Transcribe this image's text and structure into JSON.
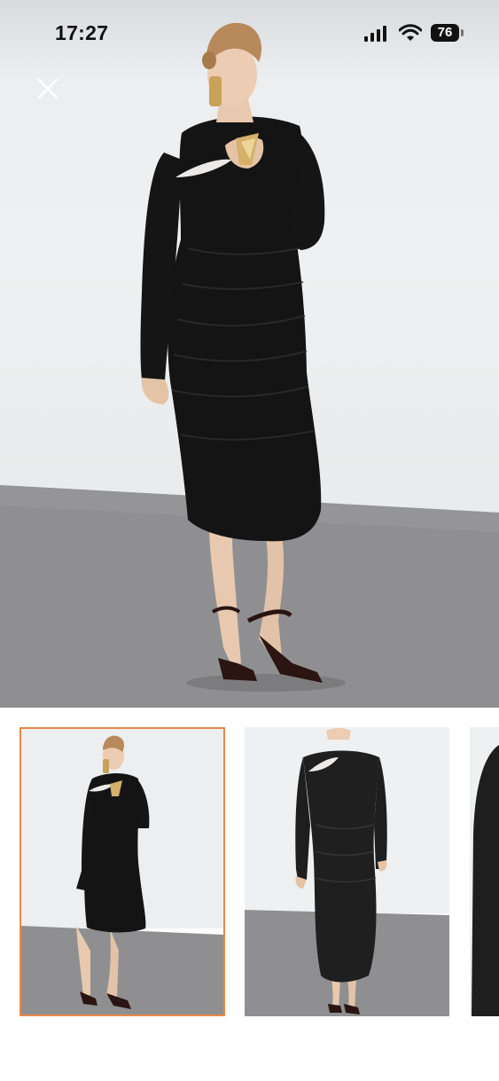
{
  "status_bar": {
    "time": "17:27",
    "battery_level": "76",
    "icons": [
      "signal-icon",
      "wifi-icon",
      "battery-icon"
    ]
  },
  "header": {
    "close_icon": "close-icon"
  },
  "gallery": {
    "selected_index": 0,
    "selected_border_color": "#e8894a",
    "thumbnail_count": 3
  },
  "colors": {
    "backdrop": "#eceef0",
    "floor": "#8e8e90",
    "dress": "#141414",
    "accent": "#e8894a"
  }
}
